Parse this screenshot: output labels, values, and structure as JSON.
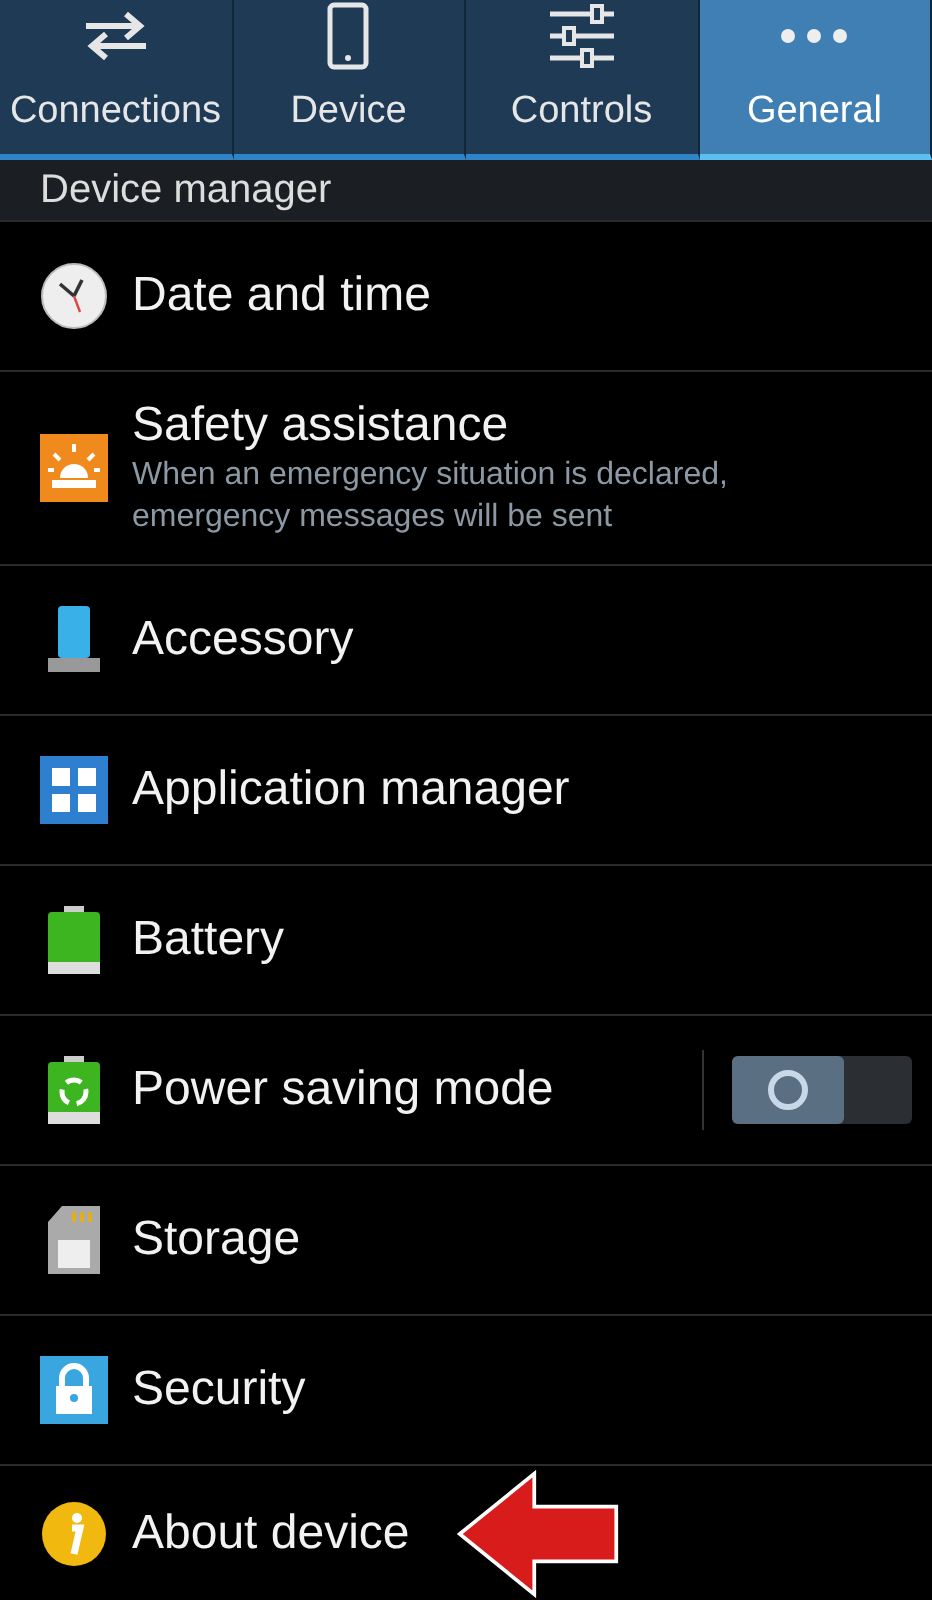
{
  "tabs": [
    {
      "label": "Connections",
      "selected": false
    },
    {
      "label": "Device",
      "selected": false
    },
    {
      "label": "Controls",
      "selected": false
    },
    {
      "label": "General",
      "selected": true
    }
  ],
  "section": {
    "title": "Device manager"
  },
  "items": [
    {
      "kind": "plain",
      "title": "Date and time",
      "arrow": false
    },
    {
      "kind": "subtitle",
      "title": "Safety assistance",
      "subtitle": "When an emergency situation is declared, emergency messages will be sent",
      "arrow": false
    },
    {
      "kind": "plain",
      "title": "Accessory",
      "arrow": false
    },
    {
      "kind": "plain",
      "title": "Application manager",
      "arrow": false
    },
    {
      "kind": "plain",
      "title": "Battery",
      "arrow": false
    },
    {
      "kind": "toggle",
      "title": "Power saving mode",
      "on": false,
      "arrow": false
    },
    {
      "kind": "plain",
      "title": "Storage",
      "arrow": false
    },
    {
      "kind": "plain",
      "title": "Security",
      "arrow": false
    },
    {
      "kind": "plain",
      "title": "About device",
      "arrow": true
    }
  ]
}
